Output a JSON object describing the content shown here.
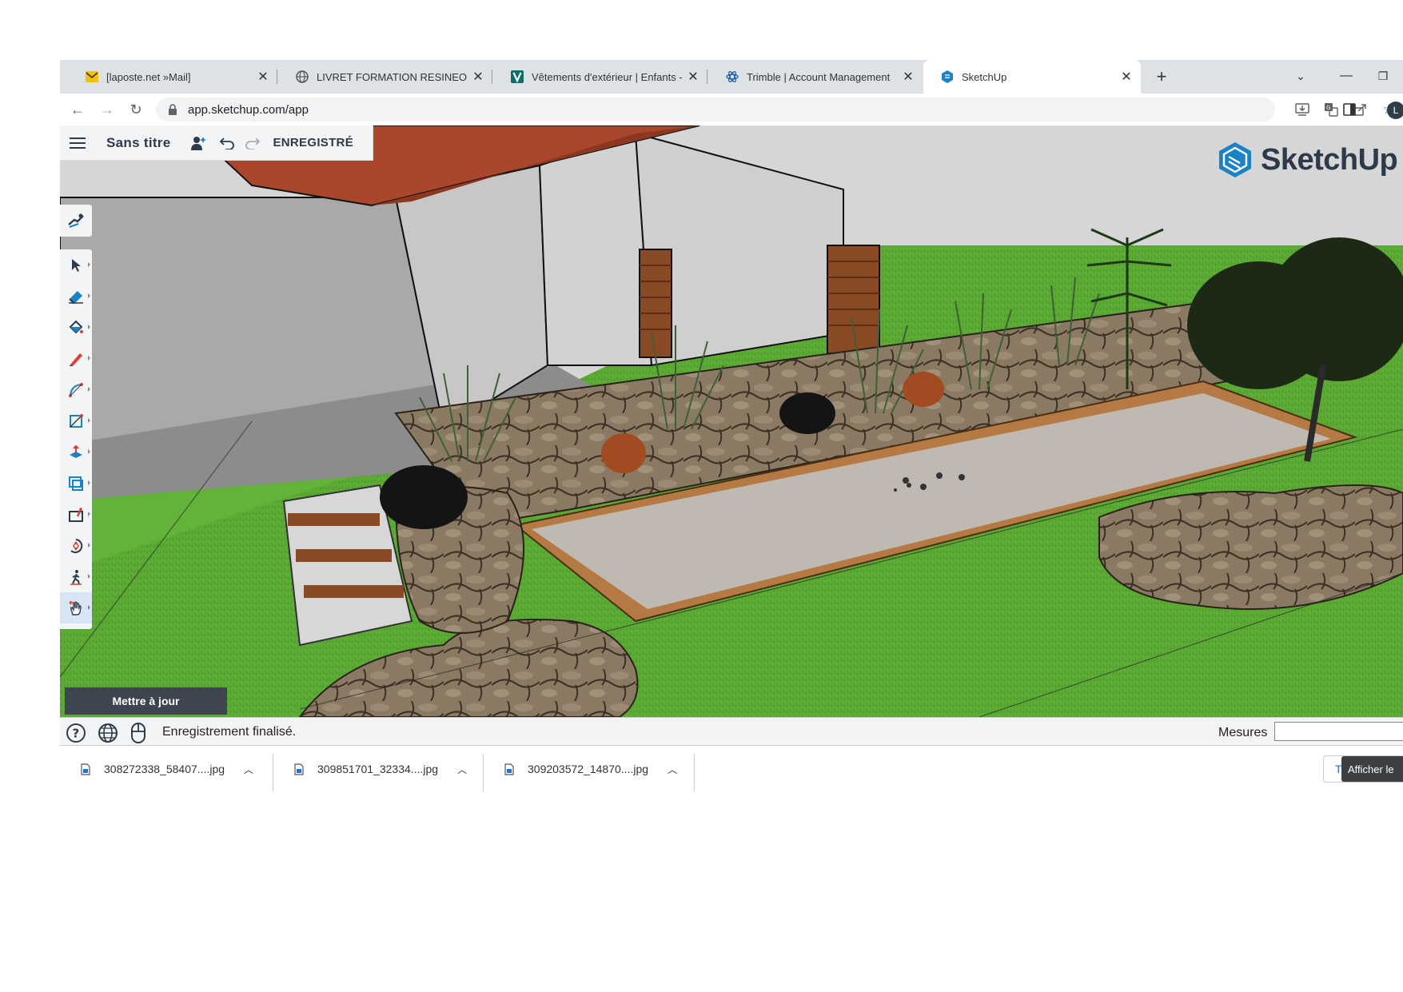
{
  "browser": {
    "tabs": [
      {
        "title": "[laposte.net »Mail]",
        "icon": "mail-icon",
        "active": false
      },
      {
        "title": "LIVRET FORMATION RESINEO FR",
        "icon": "globe-icon",
        "active": false
      },
      {
        "title": "Vêtements d'extérieur | Enfants -",
        "icon": "v-brand-icon",
        "active": false
      },
      {
        "title": "Trimble | Account Management",
        "icon": "trimble-icon",
        "active": false
      },
      {
        "title": "SketchUp",
        "icon": "sketchup-icon",
        "active": true
      }
    ],
    "url": "app.sketchup.com/app",
    "profile_initial": "L"
  },
  "app": {
    "document_title": "Sans titre",
    "save_status": "ENREGISTRÉ",
    "logo_text": "SketchUp",
    "update_button": "Mettre à jour",
    "tools": [
      {
        "name": "select-tool",
        "icon": "arrow-cursor-icon"
      },
      {
        "name": "eraser-tool",
        "icon": "eraser-icon"
      },
      {
        "name": "paint-bucket-tool",
        "icon": "paint-bucket-icon"
      },
      {
        "name": "line-tool",
        "icon": "pencil-icon"
      },
      {
        "name": "arc-tool",
        "icon": "arc-icon"
      },
      {
        "name": "rectangle-tool",
        "icon": "rectangle-icon"
      },
      {
        "name": "push-pull-tool",
        "icon": "push-pull-icon"
      },
      {
        "name": "offset-tool",
        "icon": "offset-icon"
      },
      {
        "name": "tape-measure-tool",
        "icon": "tape-measure-icon"
      },
      {
        "name": "orbit-tool",
        "icon": "orbit-icon"
      },
      {
        "name": "walk-tool",
        "icon": "walk-icon"
      },
      {
        "name": "pan-tool",
        "icon": "hand-icon",
        "active": true
      }
    ]
  },
  "statusbar": {
    "status": "Enregistrement finalisé.",
    "measures_label": "Mesures",
    "measures_value": ""
  },
  "downloads": {
    "files": [
      {
        "name": "308272338_58407....jpg"
      },
      {
        "name": "309851701_32334....jpg"
      },
      {
        "name": "309203572_14870....jpg"
      }
    ],
    "show_all_label": "T",
    "tooltip": "Afficher le"
  },
  "colors": {
    "tab_strip": "#dee1e6",
    "sketchup_navy": "#2d3a4a",
    "sketchup_blue": "#1b82c5",
    "grass": "#5cab35",
    "update_button_bg": "#3d4551"
  }
}
